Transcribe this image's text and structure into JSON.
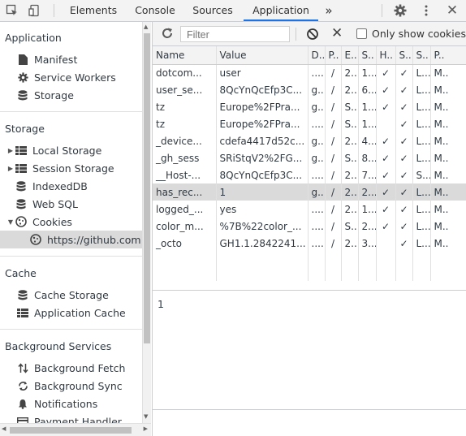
{
  "topbar": {
    "tabs": [
      {
        "label": "Elements"
      },
      {
        "label": "Console"
      },
      {
        "label": "Sources"
      },
      {
        "label": "Application"
      },
      {
        "label": "»"
      }
    ],
    "icons": [
      "inspect-icon",
      "device-toggle-icon",
      "settings-gear-icon",
      "more-menu-icon",
      "close-icon"
    ]
  },
  "sidebar": {
    "application": {
      "title": "Application",
      "items": [
        {
          "label": "Manifest",
          "icon": "document-icon"
        },
        {
          "label": "Service Workers",
          "icon": "gear-icon"
        },
        {
          "label": "Storage",
          "icon": "database-icon"
        }
      ]
    },
    "storage": {
      "title": "Storage",
      "items": [
        {
          "label": "Local Storage",
          "icon": "grid-icon",
          "expander": "collapsed"
        },
        {
          "label": "Session Storage",
          "icon": "grid-icon",
          "expander": "collapsed"
        },
        {
          "label": "IndexedDB",
          "icon": "database-icon"
        },
        {
          "label": "Web SQL",
          "icon": "database-icon"
        },
        {
          "label": "Cookies",
          "icon": "cookie-icon",
          "expander": "expanded"
        },
        {
          "label": "https://github.com",
          "icon": "cookie-icon",
          "selected": true
        }
      ]
    },
    "cache": {
      "title": "Cache",
      "items": [
        {
          "label": "Cache Storage",
          "icon": "database-icon"
        },
        {
          "label": "Application Cache",
          "icon": "grid-icon"
        }
      ]
    },
    "background": {
      "title": "Background Services",
      "items": [
        {
          "label": "Background Fetch",
          "icon": "up-down-arrows-icon"
        },
        {
          "label": "Background Sync",
          "icon": "sync-icon"
        },
        {
          "label": "Notifications",
          "icon": "bell-icon"
        },
        {
          "label": "Payment Handler",
          "icon": "card-icon"
        }
      ]
    }
  },
  "toolbar": {
    "filter_placeholder": "Filter",
    "only_show_label": "Only show cookies w"
  },
  "cookies_table": {
    "columns": [
      "Name",
      "Value",
      "D..",
      "P..",
      "E..",
      "S..",
      "H..",
      "S..",
      "S..",
      "P.."
    ],
    "rows": [
      [
        "dotcom...",
        "user",
        "....",
        "/",
        "2...",
        "1...",
        "✓",
        "✓",
        "L...",
        "M.."
      ],
      [
        "user_se...",
        "8QcYnQcEfp3C...",
        "g...",
        "/",
        "2...",
        "6...",
        "✓",
        "✓",
        "L...",
        "M.."
      ],
      [
        "tz",
        "Europe%2FPra...",
        "g...",
        "/",
        "S...",
        "1...",
        "✓",
        "✓",
        "L...",
        "M.."
      ],
      [
        "tz",
        "Europe%2FPra...",
        "....",
        "/",
        "S...",
        "1...",
        "",
        "✓",
        "L...",
        "M.."
      ],
      [
        "_device...",
        "cdefa4417d52c...",
        "g...",
        "/",
        "2...",
        "4...",
        "✓",
        "✓",
        "L...",
        "M.."
      ],
      [
        "_gh_sess",
        "SRiStqV2%2FG...",
        "g...",
        "/",
        "S...",
        "8...",
        "✓",
        "✓",
        "L...",
        "M.."
      ],
      [
        "__Host-...",
        "8QcYnQcEfp3C...",
        "....",
        "/",
        "2...",
        "7...",
        "✓",
        "✓",
        "S...",
        "M.."
      ],
      [
        "has_rec...",
        "1",
        "g...",
        "/",
        "2...",
        "2...",
        "✓",
        "✓",
        "L...",
        "M.."
      ],
      [
        "logged_...",
        "yes",
        "....",
        "/",
        "2...",
        "1...",
        "✓",
        "✓",
        "L...",
        "M.."
      ],
      [
        "color_m...",
        "%7B%22color_...",
        "....",
        "/",
        "S...",
        "2...",
        "✓",
        "✓",
        "L...",
        "M.."
      ],
      [
        "_octo",
        "GH1.1.2842241...",
        "....",
        "/",
        "2...",
        "3...",
        "",
        "✓",
        "L...",
        "M.."
      ]
    ],
    "selected_row": 7
  },
  "preview": {
    "value": "1"
  },
  "colors": {
    "accent": "#1a73e8",
    "toolbar_bg": "#f3f3f3",
    "selected_bg": "#dadada",
    "border": "#cacdd1"
  }
}
